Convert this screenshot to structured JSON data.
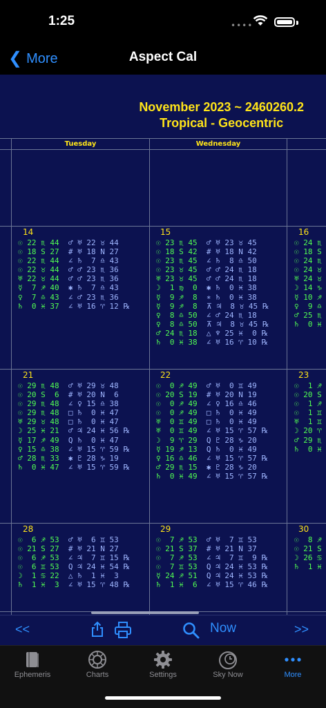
{
  "status": {
    "time": "1:25"
  },
  "nav": {
    "back": "More",
    "title": "Aspect Cal"
  },
  "calendar": {
    "title_line1": "November 2023 ~ 2460260.2",
    "title_line2": "Tropical - Geocentric",
    "day_tuesday": "Tuesday",
    "day_wednesday": "Wednesday",
    "days": {
      "d14": "14",
      "d15": "15",
      "d16": "16",
      "d21": "21",
      "d22": "22",
      "d23": "23",
      "d28": "28",
      "d29": "29",
      "d30": "30"
    },
    "cells": {
      "c14": [
        [
          "☉ 22 ♏ 44",
          "♂ ♅ 22 ♉ 44"
        ],
        [
          "☉ 18 S 27",
          "# ♅ 18 N 27"
        ],
        [
          "☉ 22 ♏ 44",
          "∠ ♄  7 ♎ 43"
        ],
        [
          "☉ 22 ♉ 44",
          "♂ ♂ 23 ♏ 36"
        ],
        [
          "♅ 22 ♉ 44",
          "♂ ♂ 23 ♏ 36"
        ],
        [
          "☿  7 ♐ 40",
          "✱ ♄  7 ♎ 43"
        ],
        [
          "♀  7 ♎ 43",
          "∠ ♂ 23 ♏ 36"
        ],
        [
          "♄  0 ♓ 37",
          "∠ ♅ 16 ♈ 12 ℞"
        ]
      ],
      "c15": [
        [
          "☉ 23 ♏ 45",
          "♂ ♅ 23 ♉ 45"
        ],
        [
          "☉ 18 S 42",
          "# ♅ 18 N 42"
        ],
        [
          "☉ 23 ♏ 45",
          "∠ ♄  8 ♎ 50"
        ],
        [
          "☉ 23 ♉ 45",
          "♂ ♂ 24 ♏ 18"
        ],
        [
          "♅ 23 ♉ 45",
          "♂ ♂ 24 ♏ 18"
        ],
        [
          "☽  1 ♍  0",
          "✱ ♄  0 ♓ 38"
        ],
        [
          "☿  9 ♐  8",
          "∗ ♄  0 ♓ 38"
        ],
        [
          "☿  9 ♐  8",
          "⊼ ♃  8 ♉ 45 ℞"
        ],
        [
          "♀  8 ♎ 50",
          "∠ ♂ 24 ♏ 18"
        ],
        [
          "♀  8 ♎ 50",
          "⊼ ♃  8 ♉ 45 ℞"
        ],
        [
          "♂ 24 ♏ 18",
          "△ ♆ 25 ♓  0 ℞"
        ],
        [
          "♄  0 ♓ 38",
          "∠ ♅ 16 ♈ 10 ℞"
        ]
      ],
      "c16": [
        [
          "☉ 24 ♏"
        ],
        [
          "☉ 18 S"
        ],
        [
          "☉ 24 ♏"
        ],
        [
          "☉ 24 ♉"
        ],
        [
          "♅ 24 ♉"
        ],
        [
          "☽ 14 ♑"
        ],
        [
          "☿ 10 ♐"
        ],
        [
          "♀  9 ♎"
        ],
        [
          "♂ 25 ♏"
        ],
        [
          "♄  0 ♓"
        ]
      ],
      "c21": [
        [
          "☉ 29 ♏ 48",
          "♂ ♅ 29 ♉ 48"
        ],
        [
          "☉ 20 S  6",
          "# ♅ 20 N  6"
        ],
        [
          "☉ 29 ♏ 48",
          "∠ ♀ 15 ♎ 38"
        ],
        [
          "☉ 29 ♏ 48",
          "□ ♄  0 ♓ 47"
        ],
        [
          "♅ 29 ♉ 48",
          "□ ♄  0 ♓ 47"
        ],
        [
          "☽ 25 ♓ 21",
          "♂ ♃ 24 ♓ 56 ℞"
        ],
        [
          "☿ 17 ♐ 49",
          "Q ♄  0 ♓ 47"
        ],
        [
          "♀ 15 ♎ 38",
          "∠ ♅ 15 ♈ 59 ℞"
        ],
        [
          "♂ 28 ♏ 33",
          "✱ ♇ 28 ♑ 19"
        ],
        [
          "♄  0 ♓ 47",
          "∠ ♅ 15 ♈ 59 ℞"
        ]
      ],
      "c22": [
        [
          "☉  0 ♐ 49",
          "♂ ♅  0 ♊ 49"
        ],
        [
          "☉ 20 S 19",
          "# ♅ 20 N 19"
        ],
        [
          "☉  0 ♐ 49",
          "∠ ♀ 16 ♎ 46"
        ],
        [
          "☉  0 ♐ 49",
          "□ ♄  0 ♓ 49"
        ],
        [
          "♅  0 ♊ 49",
          "□ ♄  0 ♓ 49"
        ],
        [
          "♅  0 ♊ 49",
          "∠ ♅ 15 ♈ 57 ℞"
        ],
        [
          "☽  9 ♈ 29",
          "Q ♇ 28 ♑ 20"
        ],
        [
          "☿ 19 ♐ 13",
          "Q ♄  0 ♓ 49"
        ],
        [
          "♀ 16 ♎ 46",
          "∠ ♅ 15 ♈ 57 ℞"
        ],
        [
          "♂ 29 ♏ 15",
          "✱ ♇ 28 ♑ 20"
        ],
        [
          "♄  0 ♓ 49",
          "∠ ♅ 15 ♈ 57 ℞"
        ]
      ],
      "c23": [
        [
          "☉  1 ♐"
        ],
        [
          "☉ 20 S"
        ],
        [
          "☉  1 ♐"
        ],
        [
          "☉  1 ♊"
        ],
        [
          "♅  1 ♊"
        ],
        [
          "☽ 20 ♈"
        ],
        [
          "♂ 29 ♏"
        ],
        [
          "♄  0 ♓"
        ]
      ],
      "c28": [
        [
          "☉  6 ♐ 53",
          "♂ ♅  6 ♊ 53"
        ],
        [
          "☉ 21 S 27",
          "# ♅ 21 N 27"
        ],
        [
          "☉  6 ♐ 53",
          "∠ ♃  7 ♊ 15 ℞"
        ],
        [
          "☉  6 ♊ 53",
          "Q ♃ 24 ♓ 54 ℞"
        ],
        [
          "☽  1 ♋ 22",
          "△ ♄  1 ♓  3"
        ],
        [
          "♄  1 ♓  3",
          "∠ ♅ 15 ♈ 48 ℞"
        ]
      ],
      "c29": [
        [
          "☉  7 ♐ 53",
          "♂ ♅  7 ♊ 53"
        ],
        [
          "☉ 21 S 37",
          "# ♅ 21 N 37"
        ],
        [
          "☉  7 ♐ 53",
          "∠ ♃  7 ♊  9 ℞"
        ],
        [
          "☉  7 ♊ 53",
          "Q ♃ 24 ♓ 53 ℞"
        ],
        [
          "☿ 24 ♐ 51",
          "Q ♃ 24 ♓ 53 ℞"
        ],
        [
          "♄  1 ♓  6",
          "∠ ♅ 15 ♈ 46 ℞"
        ]
      ],
      "c30": [
        [
          "☉  8 ♐"
        ],
        [
          "☉ 21 S"
        ],
        [
          "☽ 26 ♋"
        ],
        [
          "♄  1 ♓"
        ]
      ]
    }
  },
  "toolbar": {
    "prev": "<<",
    "now": "Now",
    "next": ">>"
  },
  "tabs": [
    {
      "label": "Ephemeris",
      "icon": "book-icon"
    },
    {
      "label": "Charts",
      "icon": "chart-wheel-icon"
    },
    {
      "label": "Settings",
      "icon": "gear-icon"
    },
    {
      "label": "Sky Now",
      "icon": "sky-clock-icon"
    },
    {
      "label": "More",
      "icon": "more-dots-icon"
    }
  ],
  "colors": {
    "accent": "#2f8fff",
    "calendar_bg": "#0c1250",
    "title": "#ffe419",
    "planet_text": "#52ff52",
    "aspect_text": "#9fb6ff"
  }
}
